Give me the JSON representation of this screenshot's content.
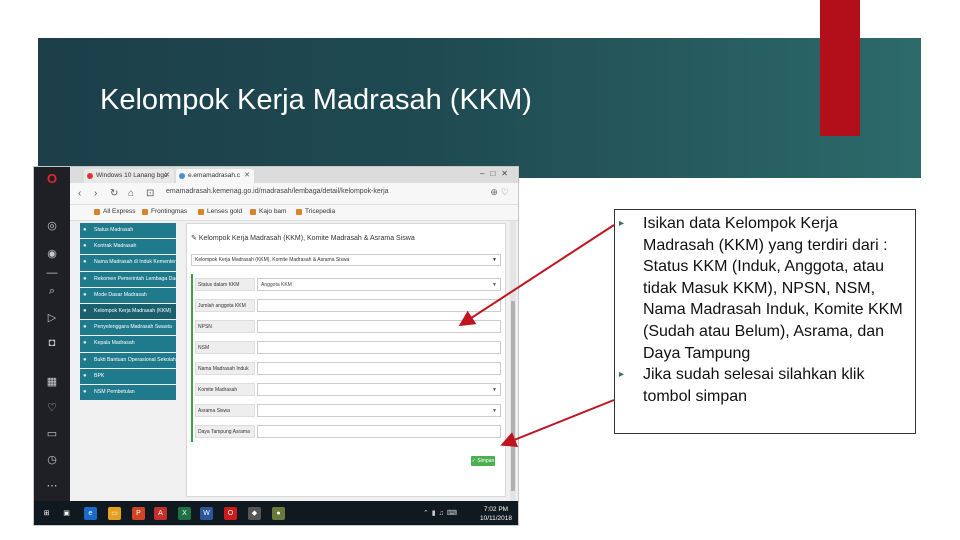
{
  "slide": {
    "title": "Kelompok Kerja Madrasah (KKM)"
  },
  "browser": {
    "tabs": [
      {
        "label": "Windows 10 Lanang bgo"
      },
      {
        "label": "e.emamadrasah.c"
      }
    ],
    "url": "emamadrasah.kemenag.go.id/madrasah/lembaga/detail/kelompok-kerja",
    "bookmarks": [
      "All Express",
      "Frontingmas",
      "Lenses gold",
      "Kajo bam",
      "Tricepedia"
    ]
  },
  "menu": {
    "items": [
      "Status Madrasah",
      "Kontrak Madrasah",
      "Nama Madrasah di Induk Kementerian",
      "Rekomen Pemerintah Lembaga Daerah",
      "Mode Dasar Madrasah",
      "Kelompok Kerja Madrasah (KKM)",
      "Penyelenggara Madrasah Swasta",
      "Kepala Madrasah",
      "Bukti Bantuan Operasional Sekolah",
      "BPK",
      "NSM Pembetulan"
    ],
    "active_index": 5
  },
  "form": {
    "heading": "Kelompok Kerja Madrasah (KKM), Komite Madrasah & Asrama Siswa",
    "subheading": "Kelompok Kerja Madrasah (KKM), Komite Madrasah & Asrama Siswa",
    "fields": [
      {
        "label": "Status dalam KKM",
        "value": "Anggota KKM",
        "select": true
      },
      {
        "label": "Jumlah anggota KKM",
        "value": "",
        "select": false
      },
      {
        "label": "NPSN",
        "value": "",
        "select": false
      },
      {
        "label": "NSM",
        "value": "",
        "select": false
      },
      {
        "label": "Nama Madrasah Induk",
        "value": "",
        "select": false
      },
      {
        "label": "Komite Madrasah",
        "value": "",
        "select": true
      },
      {
        "label": "Asrama Siswa",
        "value": "",
        "select": true
      },
      {
        "label": "Daya Tampung Asrama",
        "value": "",
        "select": false
      }
    ],
    "save_label": "Simpan"
  },
  "taskbar": {
    "time": "7:02 PM",
    "date": "10/11/2018"
  },
  "callout": {
    "points": [
      "Isikan data Kelompok Kerja Madrasah (KKM) yang terdiri dari : Status KKM (Induk, Anggota, atau tidak Masuk KKM), NPSN, NSM, Nama Madrasah Induk, Komite KKM (Sudah atau Belum), Asrama, dan Daya Tampung",
      "Jika sudah selesai silahkan klik tombol simpan"
    ]
  },
  "colors": {
    "band": "#1f4a52",
    "accent": "#b30f1a",
    "menu": "#1f7a8c",
    "arrow": "#c0151f",
    "save_button": "#4caf50"
  }
}
